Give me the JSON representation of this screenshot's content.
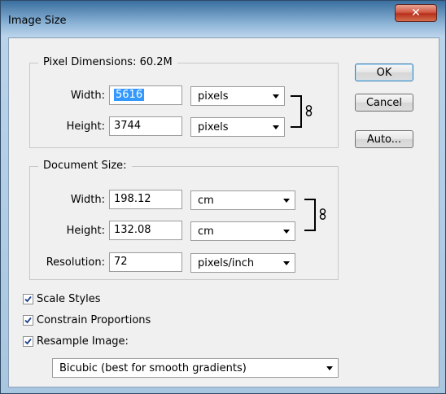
{
  "window": {
    "title": "Image Size",
    "close_glyph": "✕"
  },
  "pixel_dimensions": {
    "label": "Pixel Dimensions:",
    "size": "60.2M",
    "width_label": "Width:",
    "width_value": "5616",
    "width_unit": "pixels",
    "height_label": "Height:",
    "height_value": "3744",
    "height_unit": "pixels"
  },
  "document_size": {
    "label": "Document Size:",
    "width_label": "Width:",
    "width_value": "198.12",
    "width_unit": "cm",
    "height_label": "Height:",
    "height_value": "132.08",
    "height_unit": "cm",
    "resolution_label": "Resolution:",
    "resolution_value": "72",
    "resolution_unit": "pixels/inch"
  },
  "buttons": {
    "ok": "OK",
    "cancel": "Cancel",
    "auto": "Auto..."
  },
  "options": {
    "scale_styles": {
      "label": "Scale Styles",
      "checked": true
    },
    "constrain_proportions": {
      "label": "Constrain Proportions",
      "checked": true
    },
    "resample_image": {
      "label": "Resample Image:",
      "checked": true
    },
    "resample_method": "Bicubic (best for smooth gradients)"
  },
  "icons": {
    "chain_link": "link-icon",
    "dropdown_arrow": "chevron-down-icon",
    "check": "checkmark-icon"
  }
}
